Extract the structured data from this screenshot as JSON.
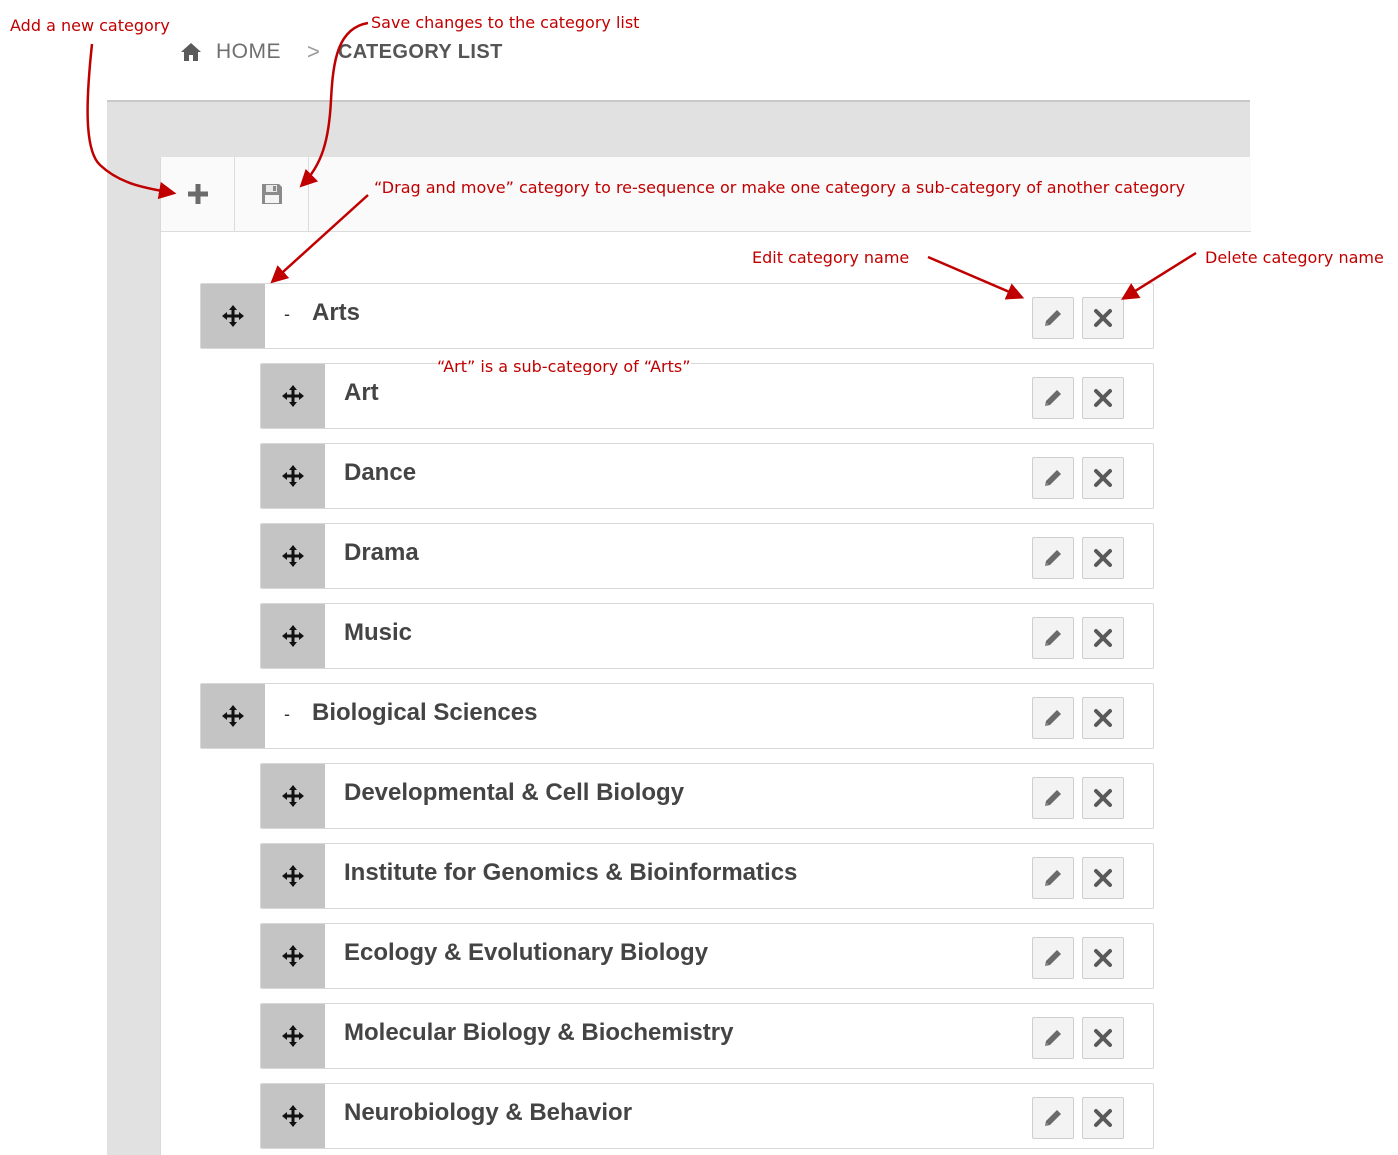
{
  "breadcrumb": {
    "home_icon": "home-icon",
    "home_label": "HOME",
    "separator": ">",
    "current": "CATEGORY LIST"
  },
  "toolbar": {
    "add_icon": "plus-icon",
    "save_icon": "floppy-disk-icon"
  },
  "categories": [
    {
      "name": "Arts",
      "level": 0,
      "prefix": "-"
    },
    {
      "name": "Art",
      "level": 1
    },
    {
      "name": "Dance",
      "level": 1
    },
    {
      "name": "Drama",
      "level": 1
    },
    {
      "name": "Music",
      "level": 1
    },
    {
      "name": "Biological Sciences",
      "level": 0,
      "prefix": "-"
    },
    {
      "name": "Developmental & Cell Biology",
      "level": 1
    },
    {
      "name": "Institute for Genomics & Bioinformatics",
      "level": 1
    },
    {
      "name": "Ecology & Evolutionary Biology",
      "level": 1
    },
    {
      "name": "Molecular Biology & Biochemistry",
      "level": 1
    },
    {
      "name": "Neurobiology & Behavior",
      "level": 1
    }
  ],
  "row_icons": {
    "handle": "move-icon",
    "edit": "pencil-icon",
    "delete": "close-icon"
  },
  "annotations": {
    "add": "Add a new category",
    "save": "Save changes to the category list",
    "drag": "“Drag and move” category to re-sequence or make one category a sub-category of another category",
    "edit": "Edit category name",
    "delete": "Delete category name",
    "subcategory": "“Art” is a sub-category of “Arts”"
  },
  "colors": {
    "annotation": "#c00000",
    "handle": "#c4c4c4",
    "frame": "#e1e1e1"
  }
}
